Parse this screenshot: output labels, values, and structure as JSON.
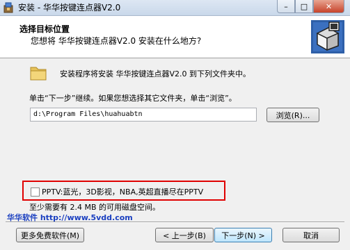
{
  "window": {
    "title": "安装 - 华华按键连点器V2.0",
    "minimize": "–",
    "maximize": "□",
    "close": "✕"
  },
  "header": {
    "title": "选择目标位置",
    "subtitle": "您想将 华华按键连点器V2.0 安装在什么地方?"
  },
  "content": {
    "intro": "安装程序将安装 华华按键连点器V2.0 到下列文件夹中。",
    "instruction": "单击“下一步”继续。如果您想选择其它文件夹，单击“浏览”。",
    "path_value": "d:\\Program Files\\huahuabtn",
    "browse_label": "浏览(R)...",
    "promo_label": "PPTV:蓝光，3D影视，NBA,英超直播尽在PPTV",
    "promo_checked": false,
    "space_note": "至少需要有 2.4 MB 的可用磁盘空间。"
  },
  "footer": {
    "brand": "华华软件 http://www.5vdd.com",
    "more_label": "更多免费软件(M)",
    "back_label": "< 上一步(B)",
    "next_label": "下一步(N) >",
    "cancel_label": "取消"
  },
  "icons": {
    "app": "installer-icon",
    "folder": "folder-icon",
    "header_art": "installer-box-icon"
  },
  "colors": {
    "promo_border": "#e00000",
    "brand_text": "#1a3fc0",
    "close_button": "#c7432a"
  }
}
